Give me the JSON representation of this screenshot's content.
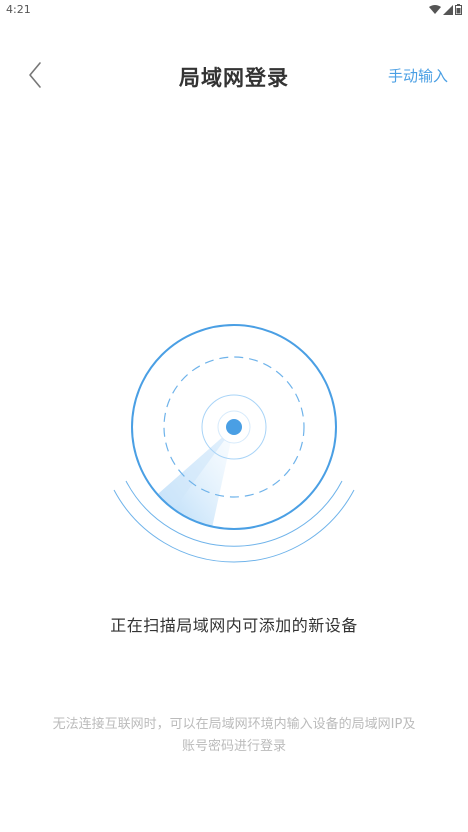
{
  "status_bar": {
    "time": "4:21",
    "icons": [
      "wifi-icon",
      "signal-icon",
      "battery-icon"
    ]
  },
  "nav": {
    "back_icon": "chevron-left-icon",
    "title": "局域网登录",
    "manual_input": "手动输入"
  },
  "radar": {
    "icon": "radar-scan-icon"
  },
  "scan_text": "正在扫描局域网内可添加的新设备",
  "hint": "无法连接互联网时，可以在局域网环境内输入设备的局域网IP及账号密码进行登录",
  "colors": {
    "accent": "#4a9fe4",
    "title": "#333333",
    "hint": "#bbbbbb"
  }
}
